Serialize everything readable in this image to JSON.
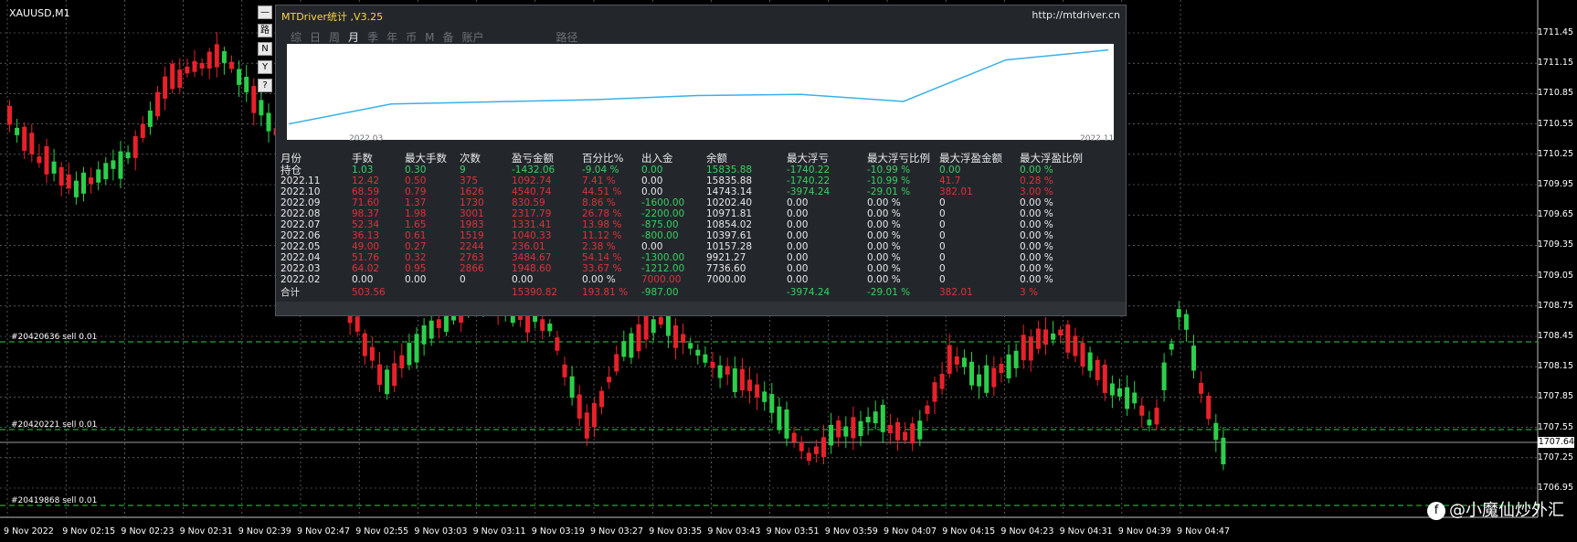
{
  "symbol": "XAUUSD,M1",
  "colors": {
    "bull": "#2ccf4a",
    "bear": "#e8212b",
    "grid": "#8a8a8a",
    "curve": "#3ab0e8"
  },
  "price_axis": [
    "1711.45",
    "1711.15",
    "1710.85",
    "1710.55",
    "1710.25",
    "1709.95",
    "1709.65",
    "1709.35",
    "1709.05",
    "1708.75",
    "1708.45",
    "1708.15",
    "1707.85",
    "1707.55",
    "1707.25",
    "1706.95"
  ],
  "current_price": "1707.64",
  "time_axis": [
    "9 Nov 2022",
    "9 Nov 02:15",
    "9 Nov 02:23",
    "9 Nov 02:31",
    "9 Nov 02:39",
    "9 Nov 02:47",
    "9 Nov 02:55",
    "9 Nov 03:03",
    "9 Nov 03:11",
    "9 Nov 03:19",
    "9 Nov 03:27",
    "9 Nov 03:35",
    "9 Nov 03:43",
    "9 Nov 03:51",
    "9 Nov 03:59",
    "9 Nov 04:07",
    "9 Nov 04:15",
    "9 Nov 04:23",
    "9 Nov 04:31",
    "9 Nov 04:39",
    "9 Nov 04:47"
  ],
  "trades": [
    "#20420636 sell 0.01",
    "#20420221 sell 0.01",
    "#20419868 sell 0.01"
  ],
  "toolbar": [
    "—",
    "路",
    "N",
    "Y",
    "?"
  ],
  "panel": {
    "title": "MTDriver统计 ,V3.25",
    "url": "http://mtdriver.cn",
    "tabs": [
      "综",
      "日",
      "周",
      "月",
      "季",
      "年",
      "币",
      "M",
      "备",
      "账户"
    ],
    "active_tab": "月",
    "path_label": "路径",
    "graph_start": "2022.03",
    "graph_end": "2022.11",
    "headers": [
      "月份",
      "手数",
      "最大手数",
      "次数",
      "盈亏金额",
      "百分比%",
      "出入金",
      "余额",
      "最大浮亏",
      "最大浮亏比例",
      "最大浮盈金额",
      "最大浮盈比例"
    ],
    "holding": [
      "持仓",
      "1.03",
      "0.30",
      "9",
      "-1432.06",
      "-9.04 %",
      "0.00",
      "15835.88",
      "-1740.22",
      "-10.99 %",
      "0.00",
      "0.00 %"
    ],
    "rows": [
      [
        "2022.11",
        "12.42",
        "0.50",
        "375",
        "1092.74",
        "7.41 %",
        "0.00",
        "15835.88",
        "-1740.22",
        "-10.99 %",
        "41.7",
        "0.28 %"
      ],
      [
        "2022.10",
        "68.59",
        "0.79",
        "1626",
        "4540.74",
        "44.51 %",
        "0.00",
        "14743.14",
        "-3974.24",
        "-29.01 %",
        "382.01",
        "3.00 %"
      ],
      [
        "2022.09",
        "71.60",
        "1.37",
        "1730",
        "830.59",
        "8.86 %",
        "-1600.00",
        "10202.40",
        "0.00",
        "0.00 %",
        "0",
        "0.00 %"
      ],
      [
        "2022.08",
        "98.37",
        "1.98",
        "3001",
        "2317.79",
        "26.78 %",
        "-2200.00",
        "10971.81",
        "0.00",
        "0.00 %",
        "0",
        "0.00 %"
      ],
      [
        "2022.07",
        "52.34",
        "1.65",
        "1983",
        "1331.41",
        "13.98 %",
        "-875.00",
        "10854.02",
        "0.00",
        "0.00 %",
        "0",
        "0.00 %"
      ],
      [
        "2022.06",
        "36.13",
        "0.61",
        "1519",
        "1040.33",
        "11.12 %",
        "-800.00",
        "10397.61",
        "0.00",
        "0.00 %",
        "0",
        "0.00 %"
      ],
      [
        "2022.05",
        "49.00",
        "0.27",
        "2244",
        "236.01",
        "2.38 %",
        "0.00",
        "10157.28",
        "0.00",
        "0.00 %",
        "0",
        "0.00 %"
      ],
      [
        "2022.04",
        "51.76",
        "0.32",
        "2763",
        "3484.67",
        "54.14 %",
        "-1300.00",
        "9921.27",
        "0.00",
        "0.00 %",
        "0",
        "0.00 %"
      ],
      [
        "2022.03",
        "64.02",
        "0.95",
        "2866",
        "1948.60",
        "33.67 %",
        "-1212.00",
        "7736.60",
        "0.00",
        "0.00 %",
        "0",
        "0.00 %"
      ],
      [
        "2022.02",
        "0.00",
        "0.00",
        "0",
        "0.00",
        "0.00 %",
        "7000.00",
        "7000.00",
        "0.00",
        "0.00 %",
        "0",
        "0.00 %"
      ]
    ],
    "total": [
      "合计",
      "503.56",
      "",
      "",
      "15390.82",
      "193.81 %",
      "-987.00",
      "",
      "-3974.24",
      "-29.01 %",
      "382.01",
      "3 %"
    ],
    "equity_curve": [
      7736.6,
      9921.27,
      10157.28,
      10397.61,
      10854.02,
      10971.81,
      10202.4,
      14743.14,
      15835.88
    ]
  },
  "watermark": "@小魔仙炒外汇"
}
